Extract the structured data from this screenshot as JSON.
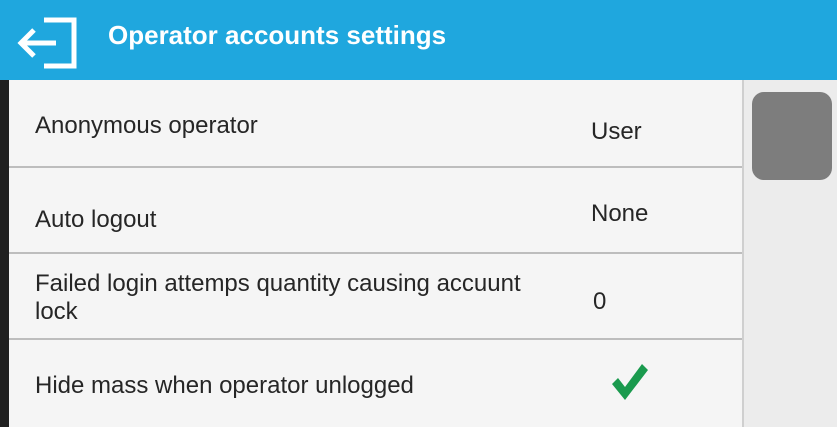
{
  "header": {
    "title": "Operator accounts settings",
    "back_icon": "exit-arrow-icon",
    "background_color": "#1fa7de"
  },
  "settings": [
    {
      "label": "Anonymous operator",
      "value": "User"
    },
    {
      "label": "Auto logout",
      "value": "None"
    },
    {
      "label": "Failed login attemps quantity causing accuunt lock",
      "value": "0"
    },
    {
      "label": "Hide mass when operator unlogged",
      "value_icon": "checkmark-icon",
      "checked": true,
      "check_color": "#1a9a4e"
    }
  ]
}
